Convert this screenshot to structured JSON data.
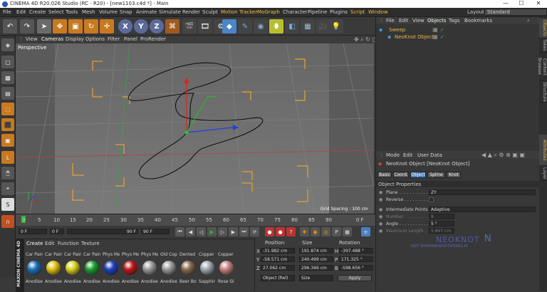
{
  "window": {
    "title": "CINEMA 4D R20.026 Studio (RC - R20) - [new1103.c4d *] - Main",
    "minimize": "—",
    "maximize": "☐",
    "close": "✕"
  },
  "menu": {
    "items": [
      "File",
      "Edit",
      "Create",
      "Select",
      "Tools",
      "Mesh",
      "Volume",
      "Snap",
      "Animate",
      "Simulate",
      "Render",
      "Sculpt",
      "Motion Tracker",
      "MoGraph",
      "Character",
      "Pipeline",
      "Plugins",
      "Script",
      "Window"
    ],
    "layout_label": "Layout:",
    "layout_value": "Standard"
  },
  "toolbar": {
    "x": "X",
    "y": "Y",
    "z": "Z"
  },
  "viewport": {
    "menu": [
      "View",
      "Cameras",
      "Display",
      "Options",
      "Filter",
      "Panel",
      "ProRender"
    ],
    "label": "Perspective",
    "grid_spacing": "Grid Spacing : 100 cm"
  },
  "timeline": {
    "ticks": [
      "0",
      "5",
      "10",
      "15",
      "20",
      "25",
      "30",
      "35",
      "40",
      "45",
      "50",
      "55",
      "60",
      "65",
      "70",
      "75",
      "80",
      "85",
      "90"
    ],
    "end": "0 F"
  },
  "playbar": {
    "current": "0 F",
    "start": "0 F",
    "max": "90 F",
    "end": "90 F"
  },
  "materials": {
    "tabs": [
      "Create",
      "Edit",
      "Function",
      "Texture"
    ],
    "top_labels": [
      "Car Pain",
      "Car Pain",
      "Car Pain",
      "Car Pain",
      "Phys Me",
      "Phys Me",
      "Phys Me",
      "Old Cop",
      "Dented",
      "Copper",
      "Copper"
    ],
    "bottom_labels": [
      "Anodise",
      "Anodise",
      "Anodise",
      "Anodise",
      "Anodise",
      "Anodise",
      "Anodise",
      "Anodise",
      "Beer Bo",
      "Sapphir",
      "Rose Gl"
    ],
    "ball_colors": [
      "#1c6fb8",
      "#e0c010",
      "#d8d020",
      "#18a030",
      "#2040c0",
      "#c01818",
      "#9a9a9a",
      "#9a9a9a",
      "#8a6a50",
      "#a0a8b0",
      "#c88080"
    ],
    "brand": "MAXON CINEMA 4D"
  },
  "coords": {
    "headers": [
      "Position",
      "Size",
      "Rotation"
    ],
    "rows": [
      {
        "axis": "X",
        "pos": "-31.982 cm",
        "size": "191.874 cm",
        "rlab": "H",
        "rot": "-397.488 °"
      },
      {
        "axis": "Y",
        "pos": "-58.571 cm",
        "size": "240.499 cm",
        "rlab": "P",
        "rot": "171.325 °"
      },
      {
        "axis": "Z",
        "pos": "27.062 cm",
        "size": "296.346 cm",
        "rlab": "B",
        "rot": "-598.656 °"
      }
    ],
    "mode": "Object (Rel)",
    "size_mode": "Size",
    "apply": "Apply"
  },
  "objects": {
    "menu": [
      "File",
      "Edit",
      "View",
      "Objects",
      "Tags",
      "Bookmarks"
    ],
    "items": [
      {
        "name": "Sweep",
        "indent": 0
      },
      {
        "name": "NeoKnot Object",
        "indent": 1
      }
    ]
  },
  "attributes": {
    "menu": [
      "Mode",
      "Edit",
      "User Data"
    ],
    "object_title": "NeoKnot Object [NeoKnot Object]",
    "tabs": [
      "Basic",
      "Coord.",
      "Object",
      "Spline",
      "Knot"
    ],
    "section": "Object Properties",
    "fields": [
      {
        "label": "Plane . . . . . . . . . . . .",
        "value": "ZY"
      },
      {
        "label": "Reverse . . . . . . . . . . .",
        "value": ""
      },
      {
        "label": "Intermediate Points",
        "value": "Adaptive"
      },
      {
        "label": "Number. . . . . . . . . . . .",
        "value": "8"
      },
      {
        "label": "Angle . . . . . . . . . . . .",
        "value": "5 °"
      },
      {
        "label": "Maximum Length. . . . . .",
        "value": "5.897 cm"
      }
    ]
  },
  "watermark": {
    "brand": "NEOKNOT",
    "url": "VISIT WWW.NEOKNOTWORKS.AT"
  },
  "side_tabs": [
    "Objects",
    "Takes",
    "Content Browser",
    "Structure",
    "Attributes",
    "Layer"
  ],
  "colors": {
    "accent": "#f0c040",
    "selected_tab": "#4a7fc0",
    "sweep": "#e6b84a",
    "neoknot": "#e6b84a",
    "spline": "#111111"
  }
}
